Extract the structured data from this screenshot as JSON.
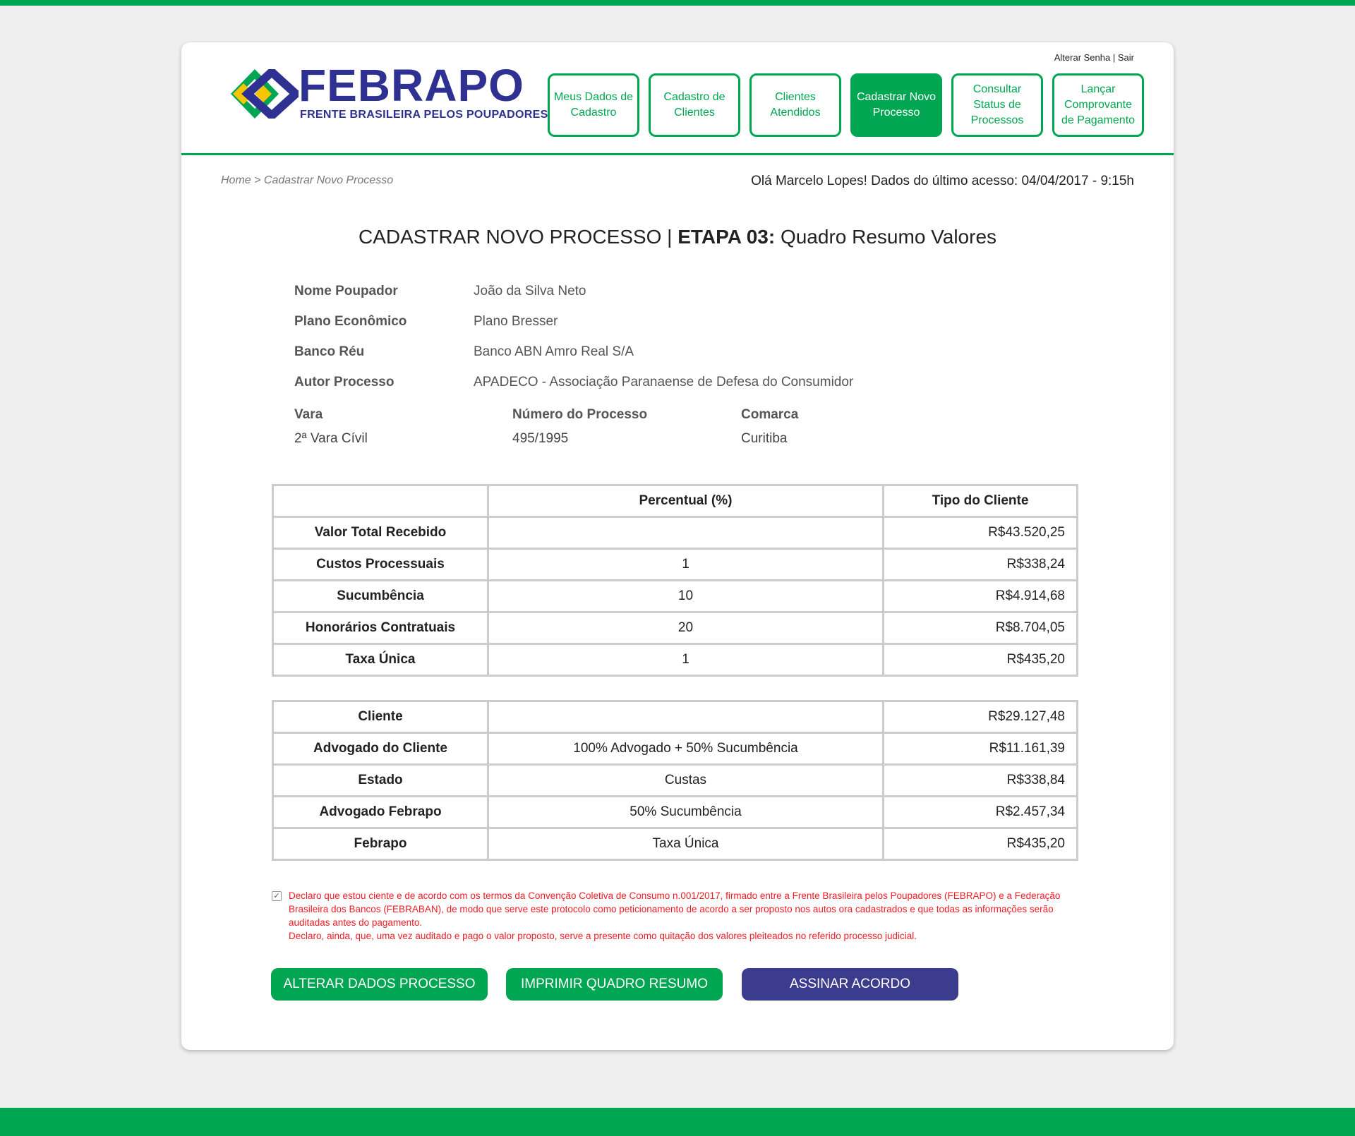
{
  "header": {
    "logo": {
      "title": "FEBRAPO",
      "subtitle": "FRENTE BRASILEIRA PELOS POUPADORES"
    },
    "top_links": {
      "change_password": "Alterar Senha",
      "separator": "|",
      "logout": "Sair"
    },
    "nav": [
      {
        "label": "Meus Dados de Cadastro"
      },
      {
        "label": "Cadastro de Clientes"
      },
      {
        "label": "Clientes Atendidos"
      },
      {
        "label": "Cadastrar Novo Processo"
      },
      {
        "label": "Consultar Status de Processos"
      },
      {
        "label": "Lançar Comprovante de Pagamento"
      }
    ]
  },
  "breadcrumb": "Home > Cadastrar Novo Processo",
  "greeting": "Olá Marcelo Lopes! Dados do último acesso: 04/04/2017 - 9:15h",
  "title": {
    "prefix": "CADASTRAR NOVO PROCESSO | ",
    "step": "ETAPA 03:",
    "suffix": " Quadro Resumo Valores"
  },
  "info": [
    {
      "label": "Nome Poupador",
      "value": "João da Silva Neto"
    },
    {
      "label": "Plano Econômico",
      "value": "Plano Bresser"
    },
    {
      "label": "Banco Réu",
      "value": "Banco ABN Amro Real S/A"
    },
    {
      "label": "Autor Processo",
      "value": "APADECO - Associação Paranaense de Defesa do Consumidor"
    }
  ],
  "process": {
    "vara": {
      "label": "Vara",
      "value": "2ª Vara Cívil"
    },
    "numero": {
      "label": "Número do Processo",
      "value": "495/1995"
    },
    "comarca": {
      "label": "Comarca",
      "value": "Curitiba"
    }
  },
  "table1": {
    "headers": [
      "",
      "Percentual (%)",
      "Tipo do Cliente"
    ],
    "rows": [
      [
        "Valor Total Recebido",
        "",
        "R$43.520,25"
      ],
      [
        "Custos Processuais",
        "1",
        "R$338,24"
      ],
      [
        "Sucumbência",
        "10",
        "R$4.914,68"
      ],
      [
        "Honorários Contratuais",
        "20",
        "R$8.704,05"
      ],
      [
        "Taxa Única",
        "1",
        "R$435,20"
      ]
    ]
  },
  "table2": {
    "rows": [
      [
        "Cliente",
        "",
        "R$29.127,48"
      ],
      [
        "Advogado do Cliente",
        "100% Advogado + 50% Sucumbência",
        "R$11.161,39"
      ],
      [
        "Estado",
        "Custas",
        "R$338,84"
      ],
      [
        "Advogado Febrapo",
        "50% Sucumbência",
        "R$2.457,34"
      ],
      [
        "Febrapo",
        "Taxa Única",
        "R$435,20"
      ]
    ]
  },
  "declaration": {
    "checked": "✓",
    "line1": "Declaro que estou ciente e de acordo com os termos da Convenção Coletiva de Consumo n.001/2017, firmado entre a Frente Brasileira pelos Poupadores (FEBRAPO) e a Federação Brasileira dos Bancos (FEBRABAN), de modo que serve este protocolo como peticionamento de acordo a ser proposto nos autos ora cadastrados e que todas as informações serão auditadas antes do pagamento.",
    "line2": "Declaro, ainda, que, uma vez auditado e pago o valor proposto, serve a presente como quitação dos valores pleiteados no referido processo judicial."
  },
  "buttons": {
    "alter": "ALTERAR DADOS PROCESSO",
    "print": "IMPRIMIR QUADRO RESUMO",
    "sign": "ASSINAR ACORDO"
  },
  "colors": {
    "primary": "#00a651",
    "brand_blue": "#2e3192",
    "sign_button": "#3c3c8f",
    "warning": "#ed1c24"
  },
  "icons": {
    "logo_mark": "interlocked-diamond-logo-icon",
    "checkbox": "checkbox-checked-icon"
  }
}
